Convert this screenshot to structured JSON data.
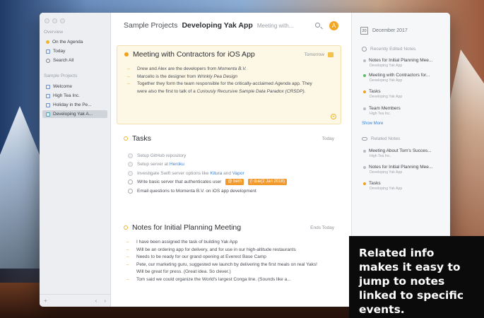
{
  "window": {
    "breadcrumb_project": "Sample Projects",
    "note_title": "Developing Yak App",
    "note_subtitle": "Meeting with...",
    "avatar_initial": "A"
  },
  "sidebar": {
    "overview_label": "Overview",
    "overview_items": [
      {
        "label": "On the Agenda",
        "icon": "agenda-dot-icon"
      },
      {
        "label": "Today",
        "icon": "calendar-icon"
      },
      {
        "label": "Search All",
        "icon": "search-icon"
      }
    ],
    "projects_label": "Sample Projects",
    "project_items": [
      {
        "label": "Welcome"
      },
      {
        "label": "High Tea Inc."
      },
      {
        "label": "Holiday in the Pe..."
      },
      {
        "label": "Developing Yak A..."
      }
    ],
    "footer": {
      "add": "+",
      "prev": "‹",
      "next": "›"
    }
  },
  "notes": [
    {
      "title": "Meeting with Contractors for iOS App",
      "date": "Tomorrow",
      "bullets": [
        {
          "pre": "Drew and Alex are the developers from ",
          "em": "Momenta B.V.",
          "post": ""
        },
        {
          "pre": "Marcello is the designer from ",
          "em": "Wrinkly Pea Design",
          "post": ""
        },
        {
          "pre": "Together they form the team responsible for the critically-acclaimed ",
          "em": "Agenda",
          "post": " app. They were also the first to talk of a ",
          "em2": "Curiously Recursive Sample Data Paradox (CRSDP)",
          "post2": "."
        }
      ]
    },
    {
      "title": "Tasks",
      "date": "Today",
      "tasks": [
        {
          "text": "Setup GitHub repository",
          "done": true
        },
        {
          "text": "Setup server at ",
          "link": "Heroku",
          "done": true
        },
        {
          "text": "Investigate Swift server options like ",
          "link": "Kitura",
          "mid": " and ",
          "link2": "Vapor",
          "done": true
        },
        {
          "text": "Write basic server that authenticates user",
          "tag1": "@ beth",
          "tag2": "(! due(2 Jan 2018)",
          "done": false
        },
        {
          "text": "Email questions to Momenta B.V. on iOS app development",
          "done": false
        }
      ]
    },
    {
      "title": "Notes for Initial Planning Meeting",
      "date": "Ends Today",
      "bullets": [
        "I have been assigned the task of building Yak App",
        "Will be an ordering app for delivery, and for use in our high-altitude restaurants",
        "Needs to be ready for our grand opening at Everest Base Camp",
        "Pete, our marketing guru, suggested we launch by delivering the first meals on real Yaks! Will be great for press. (Great idea. So clever.)",
        "Tom said we could organize the World's largest Conga line. (Sounds like a..."
      ]
    }
  ],
  "right_panel": {
    "calendar_day": "20",
    "month": "December 2017",
    "recent_label": "Recently Edited Notes",
    "recent": [
      {
        "title": "Notes for Initial Planning Mee...",
        "sub": "Developing Yak App",
        "bullet": "gray"
      },
      {
        "title": "Meeting with Contractors for...",
        "sub": "Developing Yak App",
        "bullet": "green"
      },
      {
        "title": "Tasks",
        "sub": "Developing Yak App",
        "bullet": "orange"
      },
      {
        "title": "Team Members",
        "sub": "High Tea Inc.",
        "bullet": "gray"
      }
    ],
    "show_more": "Show More",
    "related_label": "Related Notes",
    "related": [
      {
        "title": "Meeting About Tom's Succes...",
        "sub": "High Tea Inc.",
        "bullet": "gray"
      },
      {
        "title": "Notes for Initial Planning Mee...",
        "sub": "Developing Yak App",
        "bullet": "gray"
      },
      {
        "title": "Tasks",
        "sub": "Developing Yak App",
        "bullet": "orange"
      }
    ]
  },
  "callout": "Related info makes it easy to jump to notes linked to specific events."
}
